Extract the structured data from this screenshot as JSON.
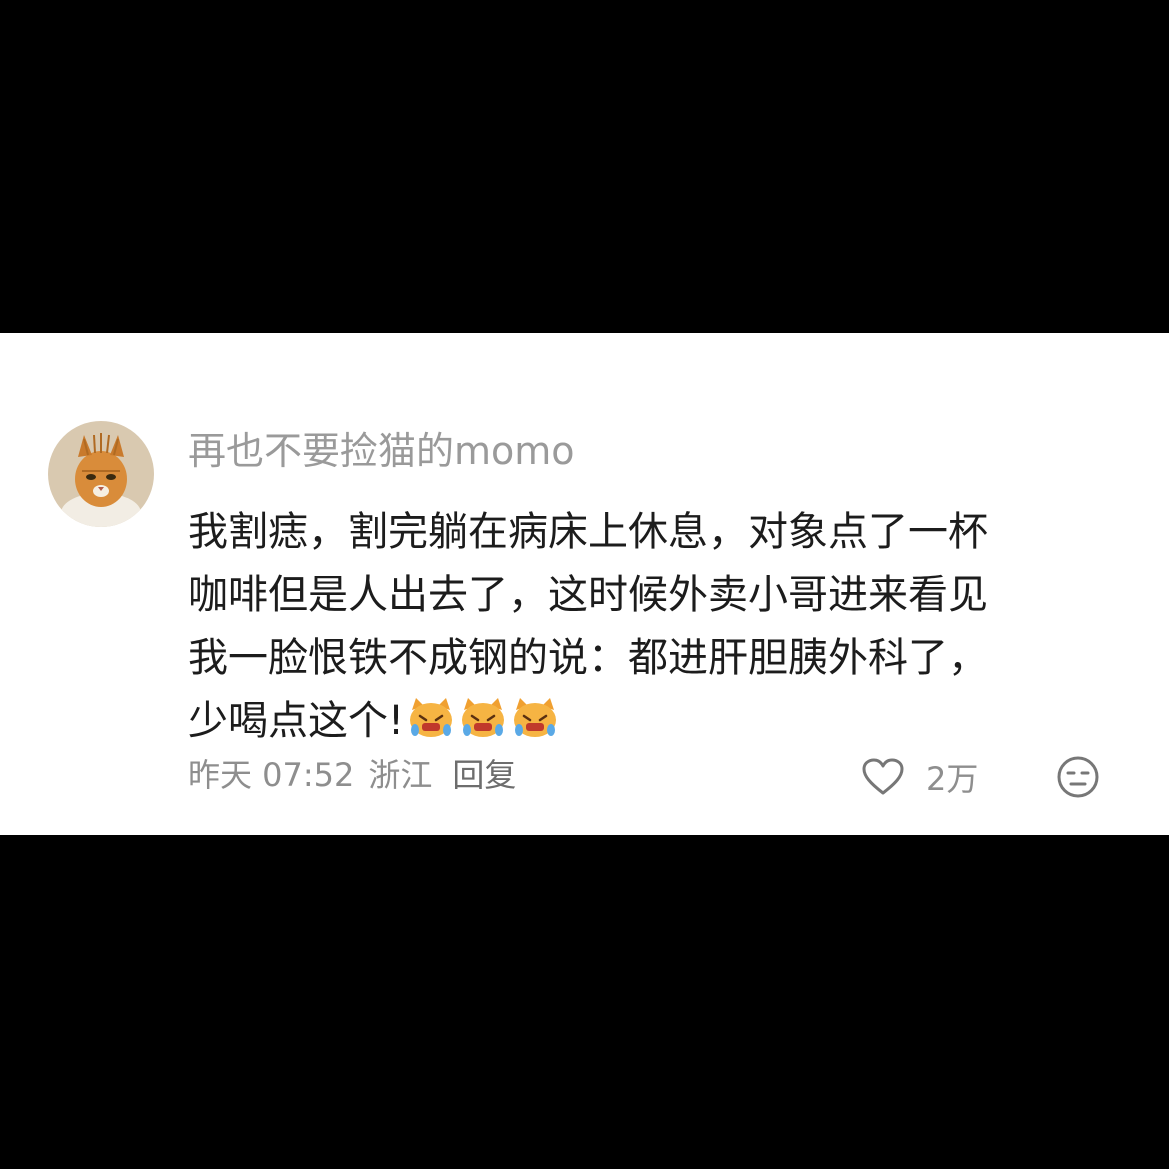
{
  "comment": {
    "username": "再也不要捡猫的momo",
    "content_lines": [
      "我割痣，割完躺在病床上休息，对象点了一杯",
      "咖啡但是人出去了，这时候外卖小哥进来看见",
      "我一脸恨铁不成钢的说：都进肝胆胰外科了，",
      "少喝点这个!"
    ],
    "emoji": [
      "crying-cat-emoji",
      "crying-cat-emoji",
      "crying-cat-emoji"
    ],
    "date": "昨天 07:52",
    "location": "浙江",
    "reply_label": "回复",
    "like_count": "2万",
    "icons": {
      "like": "heart-icon",
      "dislike": "neutral-face-icon"
    },
    "colors": {
      "background": "#ffffff",
      "letterbox": "#000000",
      "username": "#9a9a9a",
      "text": "#1c1c1c",
      "meta": "#8e8e8e"
    }
  }
}
